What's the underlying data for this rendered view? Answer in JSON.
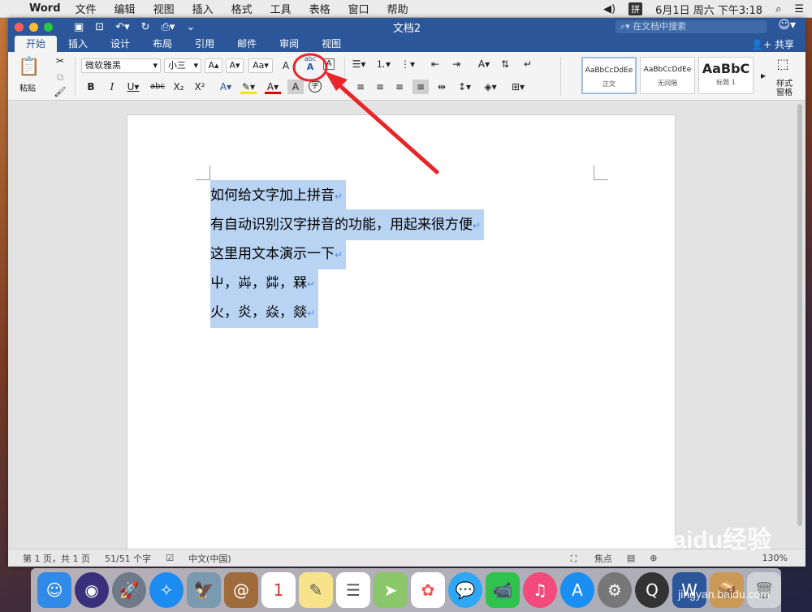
{
  "menubar": {
    "app": "Word",
    "items": [
      "文件",
      "编辑",
      "视图",
      "插入",
      "格式",
      "工具",
      "表格",
      "窗口",
      "帮助"
    ],
    "ime": "拼",
    "clock": "6月1日 周六 下午3:18"
  },
  "window": {
    "title": "文档2",
    "search_placeholder": "在文档中搜索",
    "share": "共享"
  },
  "tabs": [
    "开始",
    "插入",
    "设计",
    "布局",
    "引用",
    "邮件",
    "审阅",
    "视图"
  ],
  "ribbon": {
    "paste": "粘贴",
    "font_name": "微软雅黑",
    "font_size": "小三",
    "styles": [
      {
        "preview": "AaBbCcDdEe",
        "name": "正文"
      },
      {
        "preview": "AaBbCcDdEe",
        "name": "无间隔"
      },
      {
        "preview": "AaBbC",
        "name": "标题 1"
      }
    ],
    "styles_pane": "样式\n窗格"
  },
  "document": {
    "paragraphs": [
      "如何给文字加上拼音",
      "有自动识别汉字拼音的功能，用起来很方便",
      "这里用文本演示一下",
      "屮，芔，茻，槑",
      "火，炎，焱，燚"
    ]
  },
  "status": {
    "page": "第 1 页，共 1 页",
    "words": "51/51 个字",
    "language": "中文(中国)",
    "focus": "焦点",
    "zoom": "130%"
  },
  "watermark": {
    "brand": "Baidu经验",
    "url": "jingyan.baidu.com"
  }
}
